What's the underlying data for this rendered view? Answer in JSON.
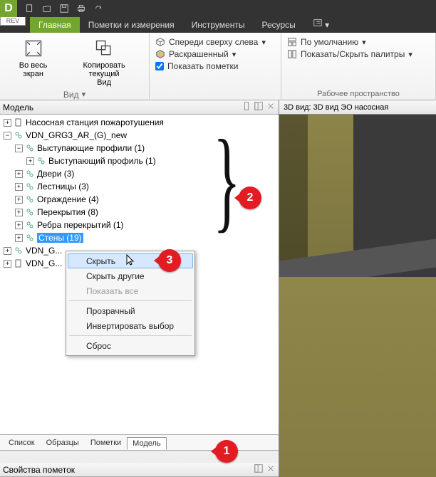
{
  "app_letter": "D",
  "rev_tab": "REV",
  "tabs": [
    "Главная",
    "Пометки и измерения",
    "Инструменты",
    "Ресурсы"
  ],
  "active_tab": 0,
  "ribbon": {
    "group1": {
      "fullscreen": "Во весь экран",
      "copyview": "Копировать текущий\nВид",
      "title": "Вид"
    },
    "group2": {
      "proj": "Спереди сверху слева",
      "colored": "Раскрашенный",
      "markups": "Показать пометки",
      "checked": true
    },
    "group3": {
      "def": "По умолчанию",
      "palettes": "Показать/Скрыть палитры",
      "title": "Рабочее пространство"
    }
  },
  "sidebar_title": "Модель",
  "view3d_title": "3D вид: 3D вид ЭО насосная",
  "tree": {
    "n0": "Насосная станция пожаротушения",
    "n1": "VDN_GRG3_AR_(G)_new",
    "n2": "Выступающие профили (1)",
    "n3": "Выступающий профиль (1)",
    "n4": "Двери (3)",
    "n5": "Лестницы (3)",
    "n6": "Ограждение (4)",
    "n7": "Перекрытия (8)",
    "n8": "Ребра перекрытий (1)",
    "n9": "Стены (19)",
    "n10": "VDN_G...",
    "n11": "VDN_G..."
  },
  "context": {
    "hide": "Скрыть",
    "hide_others": "Скрыть другие",
    "show_all": "Показать все",
    "transparent": "Прозрачный",
    "invert": "Инвертировать выбор",
    "reset": "Сброс"
  },
  "bottom_tabs": [
    "Список",
    "Образцы",
    "Пометки",
    "Модель"
  ],
  "active_btab": 3,
  "props_title": "Свойства пометок",
  "markers": {
    "m1": "1",
    "m2": "2",
    "m3": "3"
  }
}
